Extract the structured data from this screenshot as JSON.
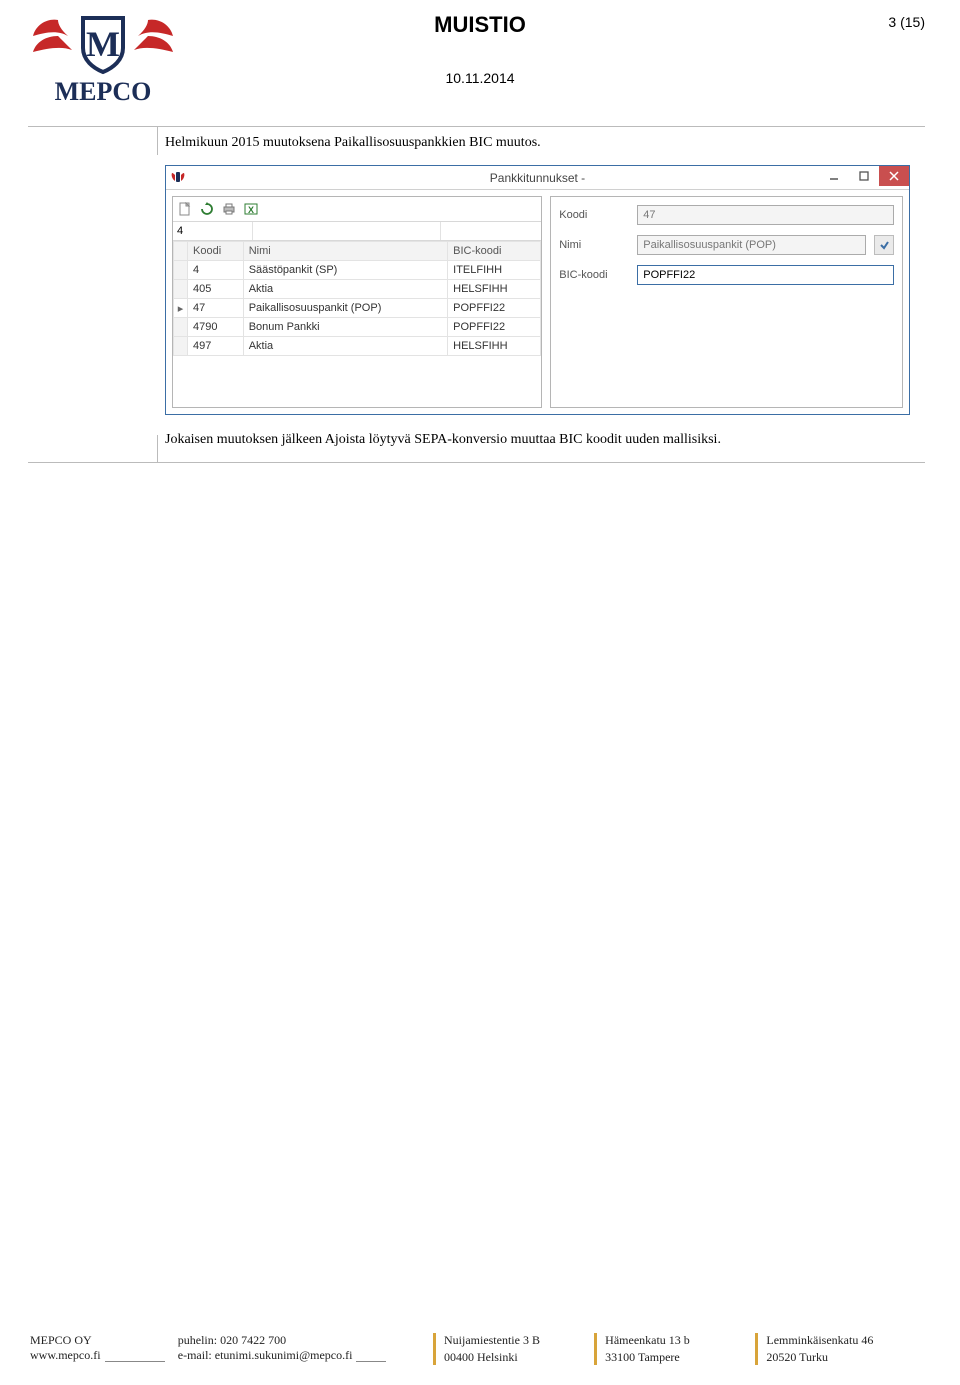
{
  "header": {
    "title": "MUISTIO",
    "page_number": "3 (15)",
    "date": "10.11.2014",
    "logo_text": "MEPCO"
  },
  "body": {
    "intro": "Helmikuun 2015 muutoksena Paikallisosuuspankkien BIC muutos.",
    "outro": "Jokaisen muutoksen jälkeen Ajoista löytyvä SEPA-konversio muuttaa BIC koodit uuden mallisiksi."
  },
  "app": {
    "window_title": "Pankkitunnukset -",
    "search_value": "4",
    "columns": {
      "c1": "Koodi",
      "c2": "Nimi",
      "c3": "BIC-koodi"
    },
    "rows": [
      {
        "koodi": "4",
        "nimi": "Säästöpankit (SP)",
        "bic": "ITELFIHH",
        "selected": false
      },
      {
        "koodi": "405",
        "nimi": "Aktia",
        "bic": "HELSFIHH",
        "selected": false
      },
      {
        "koodi": "47",
        "nimi": "Paikallisosuuspankit (POP)",
        "bic": "POPFFI22",
        "selected": true
      },
      {
        "koodi": "4790",
        "nimi": "Bonum Pankki",
        "bic": "POPFFI22",
        "selected": false
      },
      {
        "koodi": "497",
        "nimi": "Aktia",
        "bic": "HELSFIHH",
        "selected": false
      }
    ],
    "form": {
      "koodi_label": "Koodi",
      "koodi_value": "47",
      "nimi_label": "Nimi",
      "nimi_value": "Paikallisosuuspankit (POP)",
      "bic_label": "BIC-koodi",
      "bic_value": "POPFFI22"
    }
  },
  "footer": {
    "company": "MEPCO OY",
    "website": "www.mepco.fi",
    "phone_label": "puhelin:",
    "phone": "020 7422 700",
    "email_label": "e-mail:",
    "email": "etunimi.sukunimi@mepco.fi",
    "addr1_line1": "Nuijamiestentie 3 B",
    "addr1_line2": "00400 Helsinki",
    "addr2_line1": "Hämeenkatu 13 b",
    "addr2_line2": "33100 Tampere",
    "addr3_line1": "Lemminkäisenkatu 46",
    "addr3_line2": "20520 Turku"
  }
}
